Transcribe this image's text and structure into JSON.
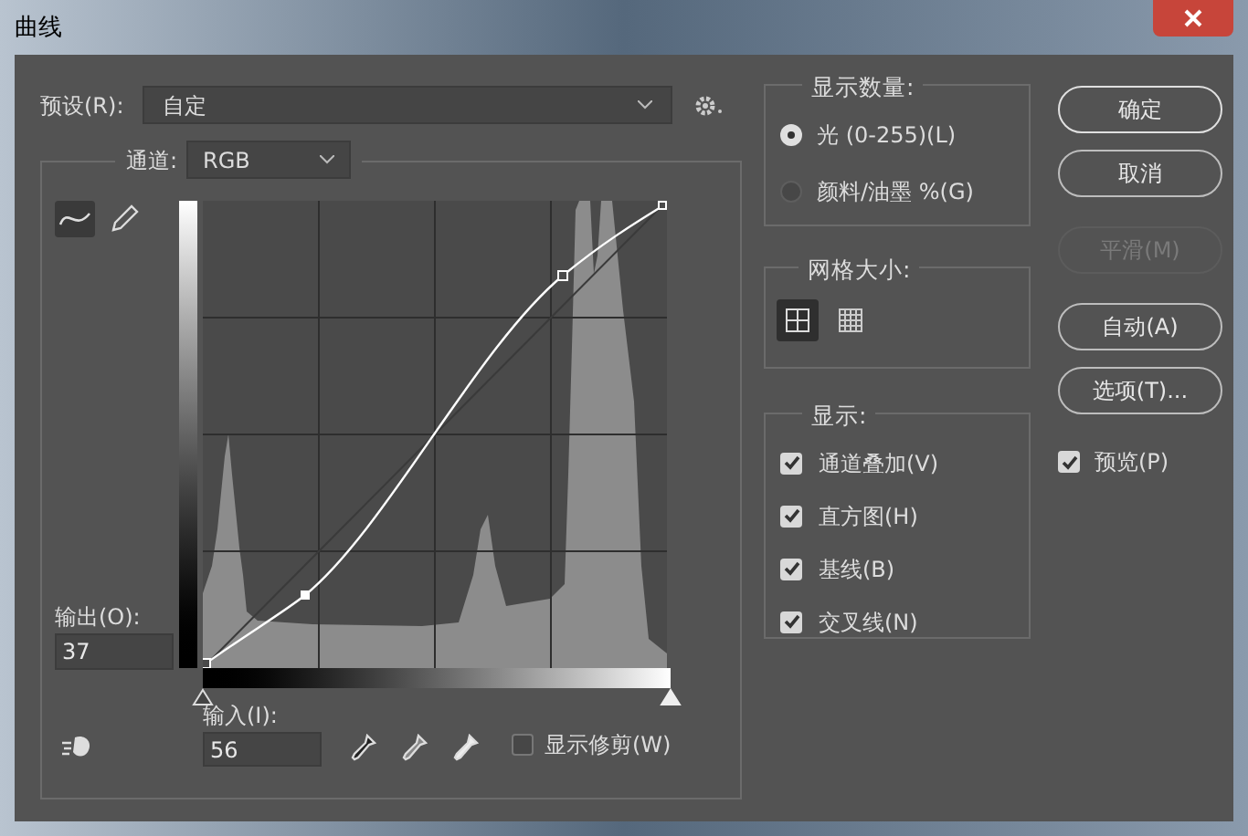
{
  "window": {
    "title": "曲线"
  },
  "preset": {
    "label": "预设(R):",
    "value": "自定"
  },
  "channel": {
    "label": "通道:",
    "value": "RGB"
  },
  "tools": [
    {
      "kind": "curve",
      "selected": true
    },
    {
      "kind": "pencil",
      "selected": false
    }
  ],
  "output": {
    "label": "输出(O):",
    "value": "37"
  },
  "input": {
    "label": "输入(I):",
    "value": "56"
  },
  "input_sliders": [
    {
      "level": 0
    },
    {
      "level": 1
    }
  ],
  "show_clipping": {
    "label": "显示修剪(W)",
    "checked": false
  },
  "display_amount": {
    "title": "显示数量:",
    "options": [
      {
        "label": "光 (0-255)(L)",
        "selected": true
      },
      {
        "label": "颜料/油墨 %(G)",
        "selected": false
      }
    ]
  },
  "grid_size": {
    "title": "网格大小:",
    "options": [
      {
        "kind": "simple",
        "selected": true
      },
      {
        "kind": "detailed",
        "selected": false
      }
    ]
  },
  "show": {
    "title": "显示:",
    "options": [
      {
        "label": "通道叠加(V)",
        "checked": true
      },
      {
        "label": "直方图(H)",
        "checked": true
      },
      {
        "label": "基线(B)",
        "checked": true
      },
      {
        "label": "交叉线(N)",
        "checked": true
      }
    ]
  },
  "buttons": [
    {
      "label": "确定",
      "disabled": false
    },
    {
      "label": "取消",
      "disabled": false
    },
    {
      "label": "平滑(M)",
      "disabled": true
    },
    {
      "label": "自动(A)",
      "disabled": false
    },
    {
      "label": "选项(T)...",
      "disabled": false
    }
  ],
  "preview": {
    "label": "预览(P)",
    "checked": true
  }
}
